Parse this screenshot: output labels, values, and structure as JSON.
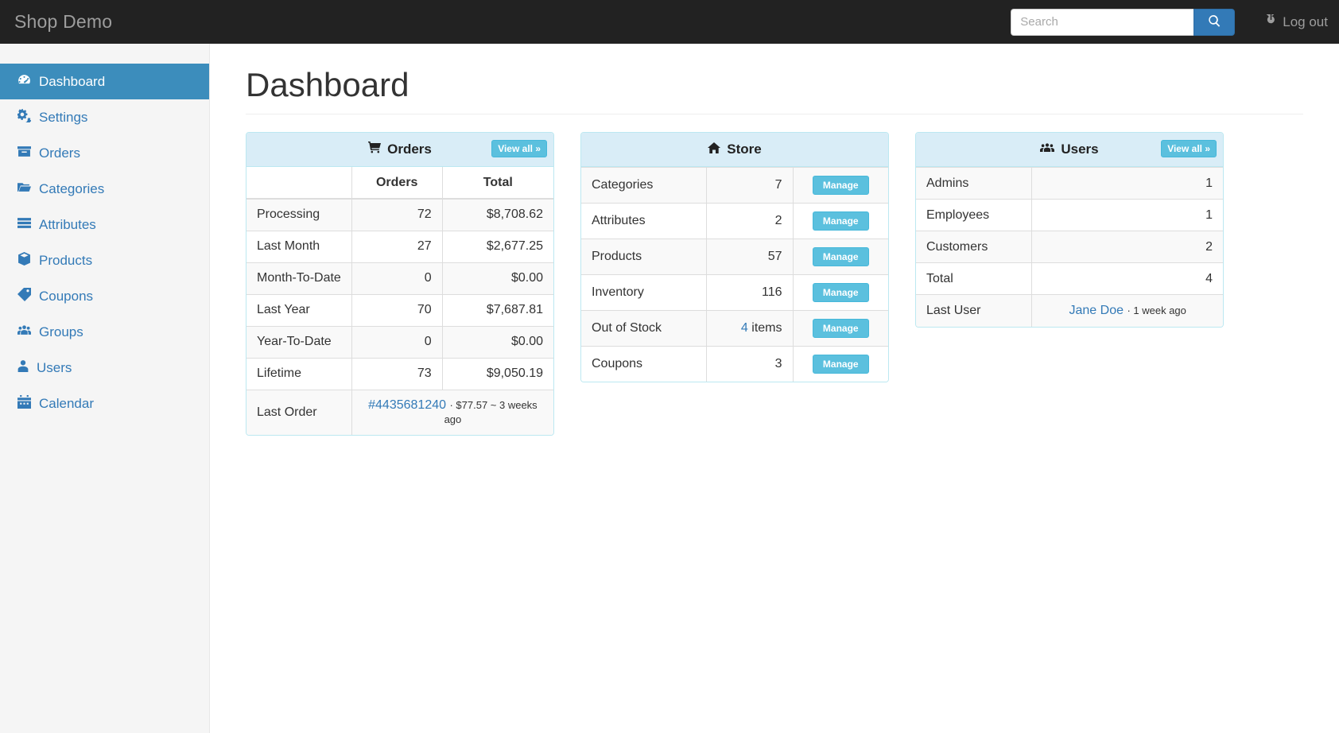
{
  "navbar": {
    "brand": "Shop Demo",
    "search_placeholder": "Search",
    "search_value": "",
    "search_icon": "search-icon",
    "logout_label": "Log out",
    "logout_icon": "power-icon"
  },
  "sidebar": {
    "items": [
      {
        "label": "Dashboard",
        "icon": "tachometer-icon",
        "active": true
      },
      {
        "label": "Settings",
        "icon": "gears-icon",
        "active": false
      },
      {
        "label": "Orders",
        "icon": "archive-icon",
        "active": false
      },
      {
        "label": "Categories",
        "icon": "folder-open-icon",
        "active": false
      },
      {
        "label": "Attributes",
        "icon": "list-icon",
        "active": false
      },
      {
        "label": "Products",
        "icon": "cube-icon",
        "active": false
      },
      {
        "label": "Coupons",
        "icon": "tag-icon",
        "active": false
      },
      {
        "label": "Groups",
        "icon": "users-icon",
        "active": false
      },
      {
        "label": "Users",
        "icon": "user-icon",
        "active": false
      },
      {
        "label": "Calendar",
        "icon": "calendar-icon",
        "active": false
      }
    ]
  },
  "main": {
    "page_title": "Dashboard",
    "panels": {
      "orders": {
        "title": "Orders",
        "icon": "shopping-cart-icon",
        "view_all": "View all »",
        "headers": [
          "",
          "Orders",
          "Total"
        ],
        "rows": [
          {
            "label": "Processing",
            "orders": "72",
            "total": "$8,708.62"
          },
          {
            "label": "Last Month",
            "orders": "27",
            "total": "$2,677.25"
          },
          {
            "label": "Month-To-Date",
            "orders": "0",
            "total": "$0.00"
          },
          {
            "label": "Last Year",
            "orders": "70",
            "total": "$7,687.81"
          },
          {
            "label": "Year-To-Date",
            "orders": "0",
            "total": "$0.00"
          },
          {
            "label": "Lifetime",
            "orders": "73",
            "total": "$9,050.19"
          }
        ],
        "last_order": {
          "label": "Last Order",
          "id": "#4435681240",
          "detail": "· $77.57 ~ 3 weeks ago"
        }
      },
      "store": {
        "title": "Store",
        "icon": "home-icon",
        "manage_label": "Manage",
        "rows": [
          {
            "label": "Categories",
            "value": "7",
            "value_link": false,
            "suffix": ""
          },
          {
            "label": "Attributes",
            "value": "2",
            "value_link": false,
            "suffix": ""
          },
          {
            "label": "Products",
            "value": "57",
            "value_link": false,
            "suffix": ""
          },
          {
            "label": "Inventory",
            "value": "116",
            "value_link": false,
            "suffix": ""
          },
          {
            "label": "Out of Stock",
            "value": "4",
            "value_link": true,
            "suffix": " items"
          },
          {
            "label": "Coupons",
            "value": "3",
            "value_link": false,
            "suffix": ""
          }
        ]
      },
      "users": {
        "title": "Users",
        "icon": "users-group-icon",
        "view_all": "View all »",
        "rows": [
          {
            "label": "Admins",
            "value": "1"
          },
          {
            "label": "Employees",
            "value": "1"
          },
          {
            "label": "Customers",
            "value": "2"
          },
          {
            "label": "Total",
            "value": "4"
          }
        ],
        "last_user": {
          "label": "Last User",
          "name": "Jane Doe",
          "detail": "· 1 week ago"
        }
      }
    }
  },
  "colors": {
    "navbar_bg": "#222222",
    "sidebar_bg": "#f5f5f5",
    "active_blue": "#3c8dbc",
    "link_blue": "#337ab7",
    "panel_head": "#d9edf7",
    "panel_border": "#bce8f1",
    "info_btn": "#5bc0de"
  }
}
